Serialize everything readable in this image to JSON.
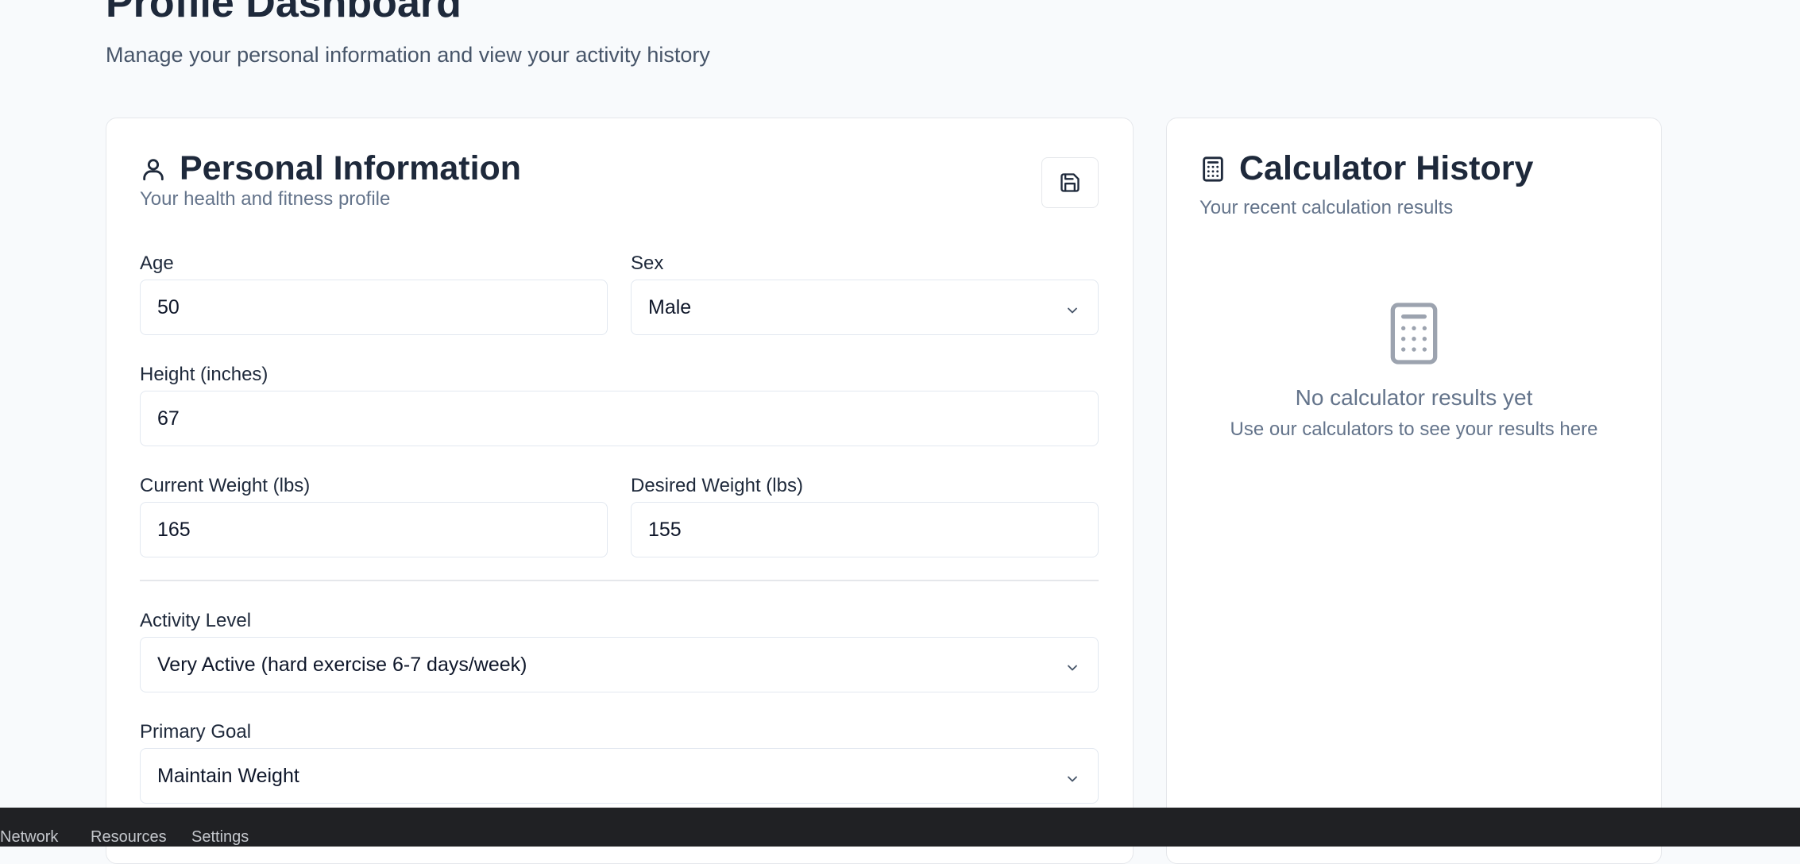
{
  "page": {
    "title": "Profile Dashboard",
    "subtitle": "Manage your personal information and view your activity history"
  },
  "personal": {
    "title": "Personal Information",
    "description": "Your health and fitness profile",
    "icon": "user-icon",
    "save_icon": "save-icon",
    "fields": {
      "age": {
        "label": "Age",
        "value": "50"
      },
      "sex": {
        "label": "Sex",
        "value": "Male"
      },
      "height": {
        "label": "Height (inches)",
        "value": "67"
      },
      "current_weight": {
        "label": "Current Weight (lbs)",
        "value": "165"
      },
      "desired_weight": {
        "label": "Desired Weight (lbs)",
        "value": "155"
      },
      "activity_level": {
        "label": "Activity Level",
        "value": "Very Active (hard exercise 6-7 days/week)"
      },
      "primary_goal": {
        "label": "Primary Goal",
        "value": "Maintain Weight"
      }
    }
  },
  "history": {
    "title": "Calculator History",
    "description": "Your recent calculation results",
    "icon": "calculator-icon",
    "empty_title": "No calculator results yet",
    "empty_description": "Use our calculators to see your results here"
  },
  "bottom_bar": {
    "items": [
      "Network",
      "Resources",
      "Settings"
    ]
  },
  "colors": {
    "background": "#f8fafc",
    "card": "#ffffff",
    "border": "#e5e7eb",
    "heading": "#1e293b",
    "muted": "#64748b",
    "devtools_bar": "#202124"
  }
}
